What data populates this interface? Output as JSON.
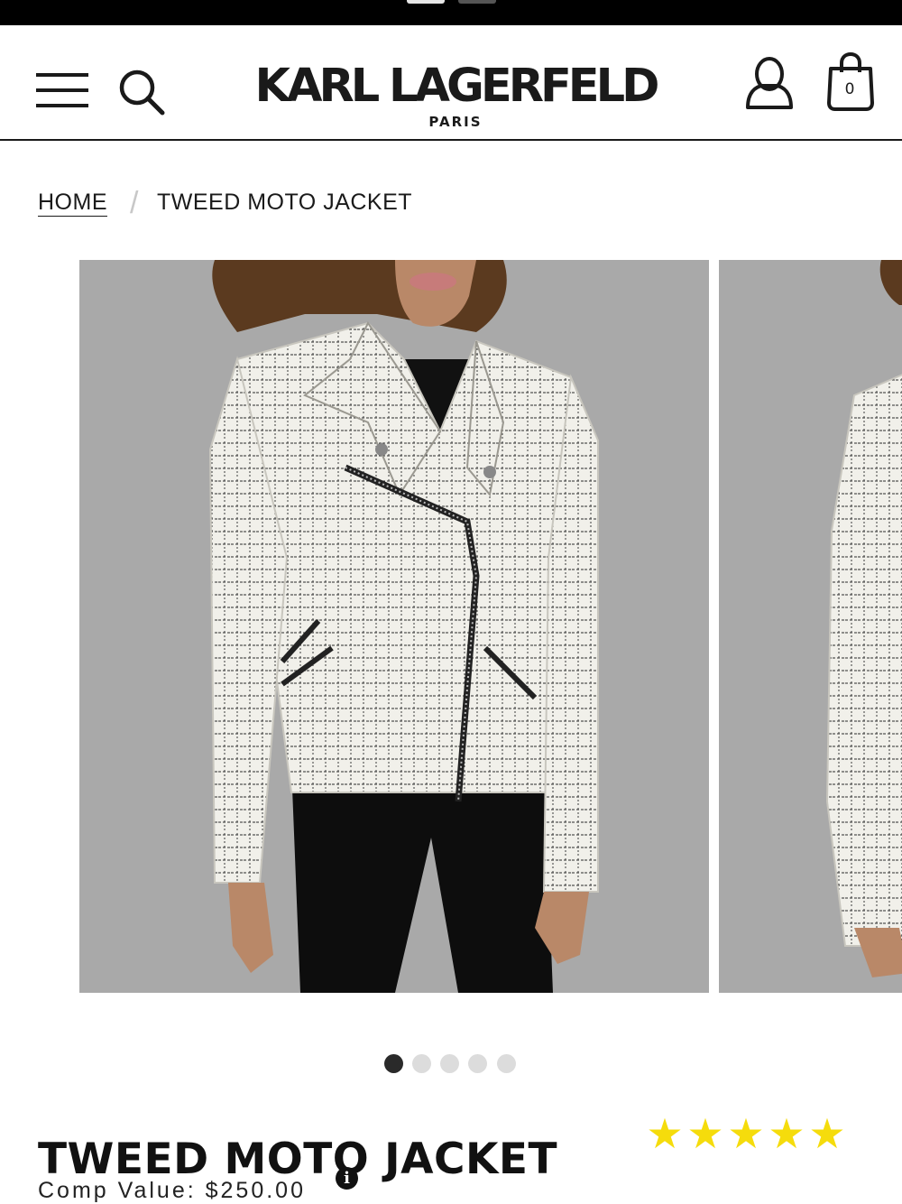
{
  "header": {
    "brand": "KARL LAGERFELD",
    "brand_sub": "PARIS",
    "bag_count": "0",
    "icons": [
      "menu-icon",
      "search-icon",
      "account-icon",
      "shopping-bag-icon"
    ]
  },
  "breadcrumb": {
    "home": "HOME",
    "separator": "/",
    "current": "TWEED MOTO JACKET"
  },
  "gallery": {
    "slide_count": 5,
    "active_index": 0
  },
  "product": {
    "title": "TWEED MOTO JACKET",
    "rating": 5,
    "rating_max": 5,
    "star_color": "#f5dc0c",
    "comp_value": "Comp Value: $250.00",
    "info_symbol": "i"
  }
}
